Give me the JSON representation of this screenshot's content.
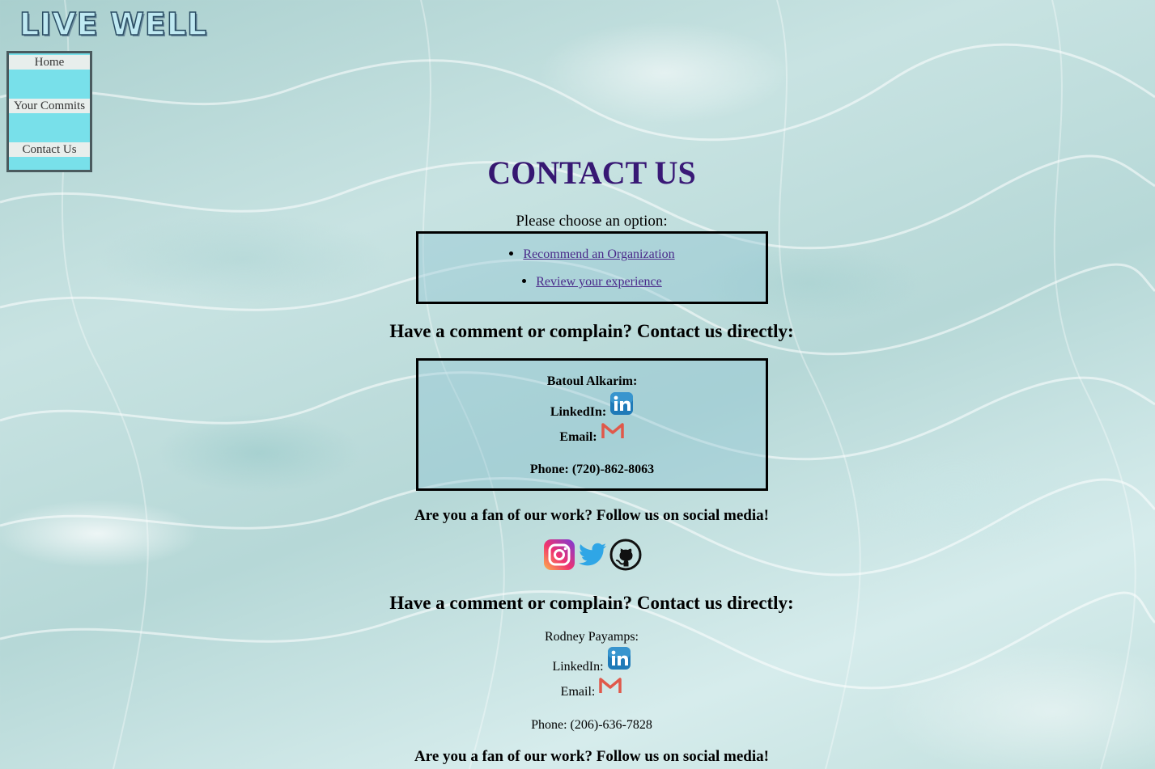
{
  "logo": {
    "text": "LIVE WELL"
  },
  "nav": {
    "items": [
      {
        "label": "Home"
      },
      {
        "label": "Your Commits"
      },
      {
        "label": "Contact Us"
      }
    ]
  },
  "main": {
    "title": "CONTACT US",
    "choose_text": "Please choose an option:",
    "options": [
      {
        "label": "Recommend an Organization"
      },
      {
        "label": "Review your experience"
      }
    ],
    "comment_heading": "Have a comment or complain? Contact us directly:",
    "fan_text": "Are you a fan of our work? Follow us on social media!"
  },
  "contacts": [
    {
      "name": "Batoul Alkarim:",
      "linkedin_label": "LinkedIn:",
      "email_label": "Email:",
      "phone": "Phone: (720)-862-8063"
    },
    {
      "name": "Rodney Payamps:",
      "linkedin_label": "LinkedIn:",
      "email_label": "Email:",
      "phone": "Phone: (206)-636-7828"
    }
  ],
  "social": {
    "icons": [
      "instagram-icon",
      "twitter-icon",
      "github-icon"
    ]
  },
  "colors": {
    "title": "#2c0f5e",
    "nav_bg": "#78e0ea",
    "link": "#4a2a8a"
  }
}
